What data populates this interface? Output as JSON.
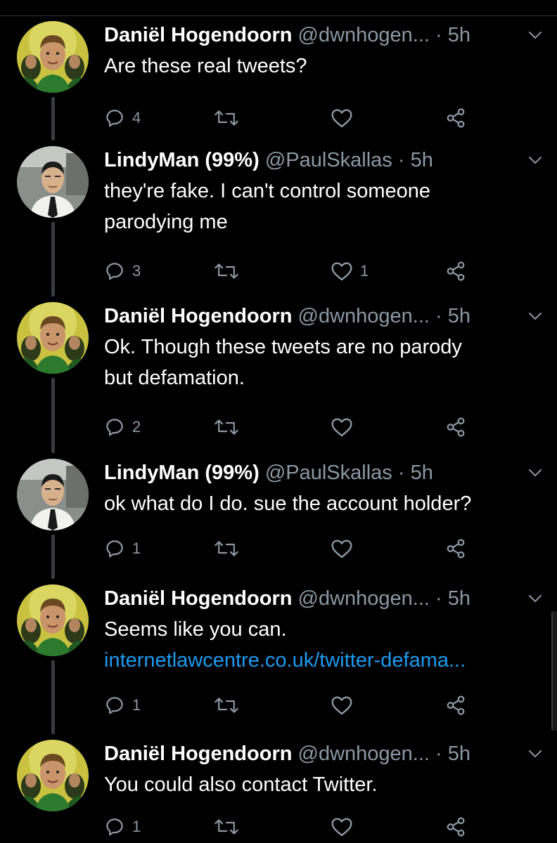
{
  "colors": {
    "background": "#000000",
    "text": "#ffffff",
    "secondary": "#8b98a5",
    "link": "#1d9bf0",
    "thread_line": "#3a3d40"
  },
  "tweets": [
    {
      "name": "Daniël Hogendoorn",
      "handle": "@dwnhogen...",
      "separator": "·",
      "time": "5h",
      "text": [
        "Are these real tweets?"
      ],
      "link": "",
      "reply_count": "4",
      "retweet_count": "",
      "like_count": ""
    },
    {
      "name": "LindyMan (99%)",
      "handle": "@PaulSkallas",
      "separator": "·",
      "time": "5h",
      "text": [
        "they're fake. I can't control someone",
        "parodying me"
      ],
      "link": "",
      "reply_count": "3",
      "retweet_count": "",
      "like_count": "1"
    },
    {
      "name": "Daniël Hogendoorn",
      "handle": "@dwnhogen...",
      "separator": "·",
      "time": "5h",
      "text": [
        "Ok. Though these tweets are no parody",
        "but defamation."
      ],
      "link": "",
      "reply_count": "2",
      "retweet_count": "",
      "like_count": ""
    },
    {
      "name": "LindyMan (99%)",
      "handle": "@PaulSkallas",
      "separator": "·",
      "time": "5h",
      "text": [
        "ok what do I do. sue the account holder?"
      ],
      "link": "",
      "reply_count": "1",
      "retweet_count": "",
      "like_count": ""
    },
    {
      "name": "Daniël Hogendoorn",
      "handle": "@dwnhogen...",
      "separator": "·",
      "time": "5h",
      "text": [
        "Seems like you can."
      ],
      "link": "internetlawcentre.co.uk/twitter-defama...",
      "reply_count": "1",
      "retweet_count": "",
      "like_count": ""
    },
    {
      "name": "Daniël Hogendoorn",
      "handle": "@dwnhogen...",
      "separator": "·",
      "time": "5h",
      "text": [
        "You could also contact Twitter."
      ],
      "link": "",
      "reply_count": "1",
      "retweet_count": "",
      "like_count": ""
    }
  ],
  "icons": {
    "reply": "reply-icon",
    "retweet": "retweet-icon",
    "like": "heart-icon",
    "share": "share-icon",
    "more": "chevron-down-icon",
    "avatar_daniel": "avatar-photo-daniel",
    "avatar_lindyman": "avatar-photo-lindyman"
  }
}
